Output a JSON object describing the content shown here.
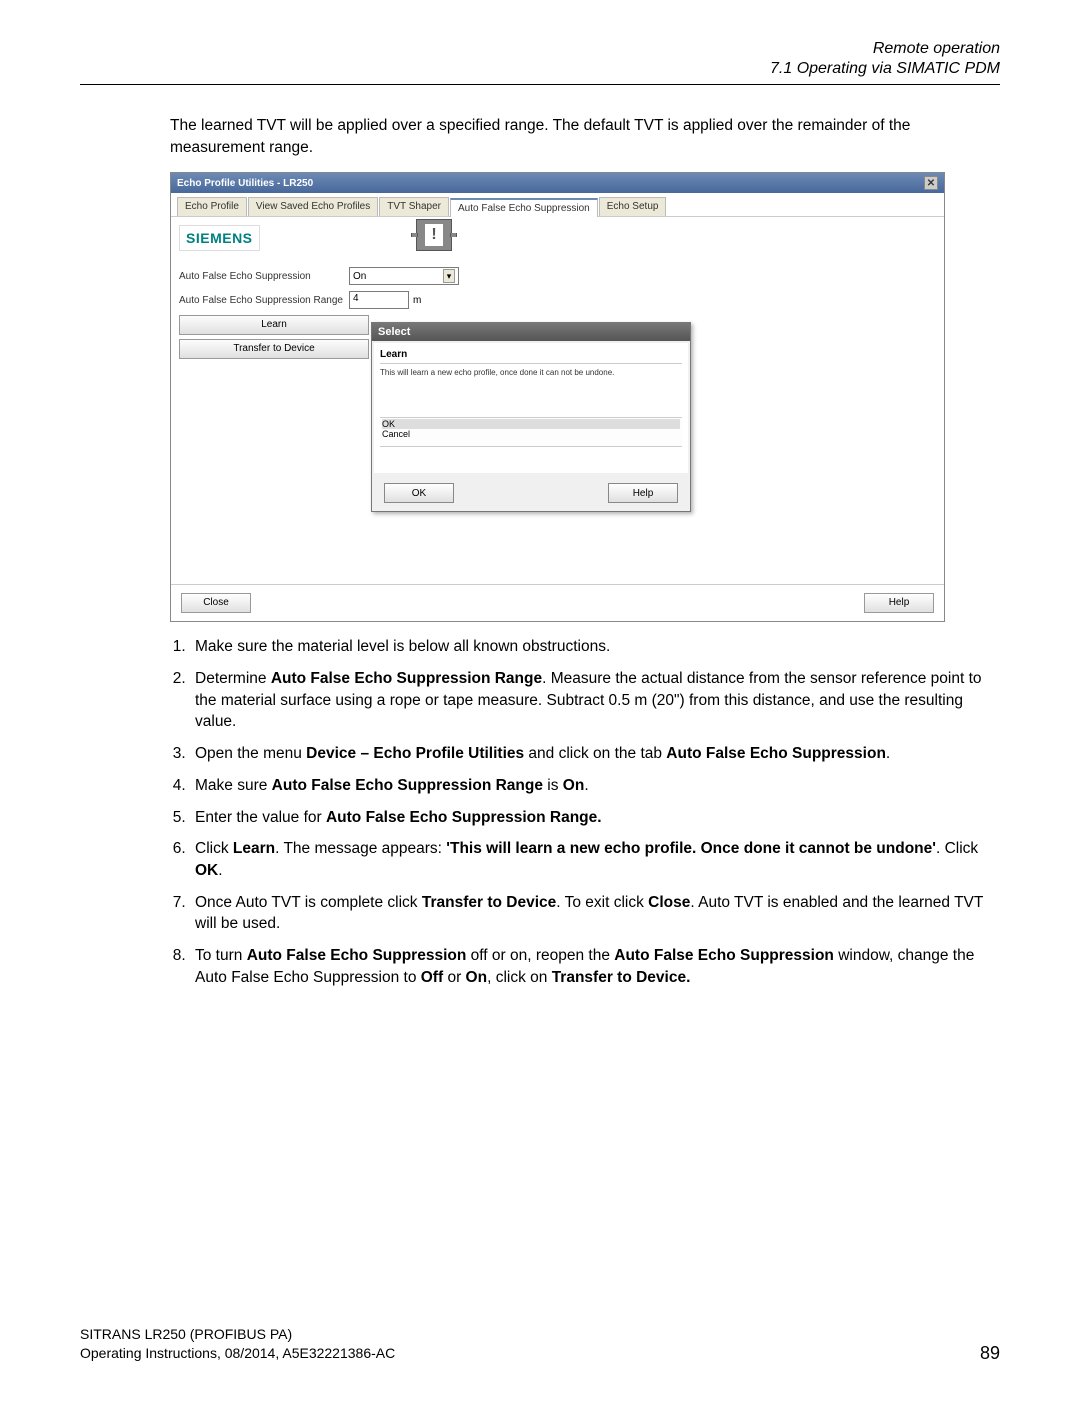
{
  "header": {
    "title": "Remote operation",
    "subtitle": "7.1 Operating via SIMATIC PDM"
  },
  "intro": "The learned TVT will be applied over a specified range. The default TVT is applied over the remainder of the measurement range.",
  "window": {
    "title": "Echo Profile Utilities - LR250",
    "tabs": [
      "Echo Profile",
      "View Saved Echo Profiles",
      "TVT Shaper",
      "Auto False Echo Suppression",
      "Echo Setup"
    ],
    "active_tab": 3,
    "brand": "SIEMENS",
    "fields": {
      "afes_label": "Auto False Echo Suppression",
      "afes_value": "On",
      "range_label": "Auto False Echo Suppression Range",
      "range_value": "4",
      "range_unit": "m"
    },
    "buttons": {
      "learn": "Learn",
      "transfer": "Transfer to Device"
    },
    "dialog": {
      "title": "Select",
      "sub_title": "Learn",
      "message": "This will learn a new echo profile, once done it can not be undone.",
      "opts": [
        "OK",
        "Cancel"
      ],
      "ok": "OK",
      "help": "Help"
    },
    "footer": {
      "close": "Close",
      "help": "Help"
    }
  },
  "steps": {
    "s1": "Make sure the material level is below all known obstructions.",
    "s2_a": "Determine ",
    "s2_b": "Auto False Echo Suppression Range",
    "s2_c": ". Measure the actual distance from the sensor reference point to the material surface using a rope or tape measure. Subtract 0.5 m (20\") from this distance, and use the resulting value.",
    "s3_a": "Open the menu ",
    "s3_b": "Device – Echo Profile Utilities",
    "s3_c": " and click on the tab ",
    "s3_d": "Auto False Echo Suppression",
    "s3_e": ".",
    "s4_a": "Make sure ",
    "s4_b": "Auto False Echo Suppression Range",
    "s4_c": " is ",
    "s4_d": "On",
    "s4_e": ".",
    "s5_a": "Enter the value for ",
    "s5_b": "Auto False Echo Suppression Range.",
    "s6_a": "Click ",
    "s6_b": "Learn",
    "s6_c": ". The message appears: ",
    "s6_d": "'This will learn a new echo profile. Once done it cannot be undone'",
    "s6_e": ". Click ",
    "s6_f": "OK",
    "s6_g": ".",
    "s7_a": "Once Auto TVT is complete click ",
    "s7_b": "Transfer to Device",
    "s7_c": ". To exit click ",
    "s7_d": "Close",
    "s7_e": ". Auto TVT is enabled and the learned TVT will be used.",
    "s8_a": "To turn ",
    "s8_b": "Auto False Echo Suppression",
    "s8_c": " off or on, reopen the ",
    "s8_d": "Auto False Echo Suppression",
    "s8_e": " window, change the Auto False Echo Suppression to ",
    "s8_f": "Off",
    "s8_g": " or ",
    "s8_h": "On",
    "s8_i": ", click on ",
    "s8_j": "Transfer to Device."
  },
  "footer": {
    "line1": "SITRANS LR250 (PROFIBUS PA)",
    "line2": "Operating Instructions, 08/2014, A5E32221386-AC",
    "page": "89"
  }
}
